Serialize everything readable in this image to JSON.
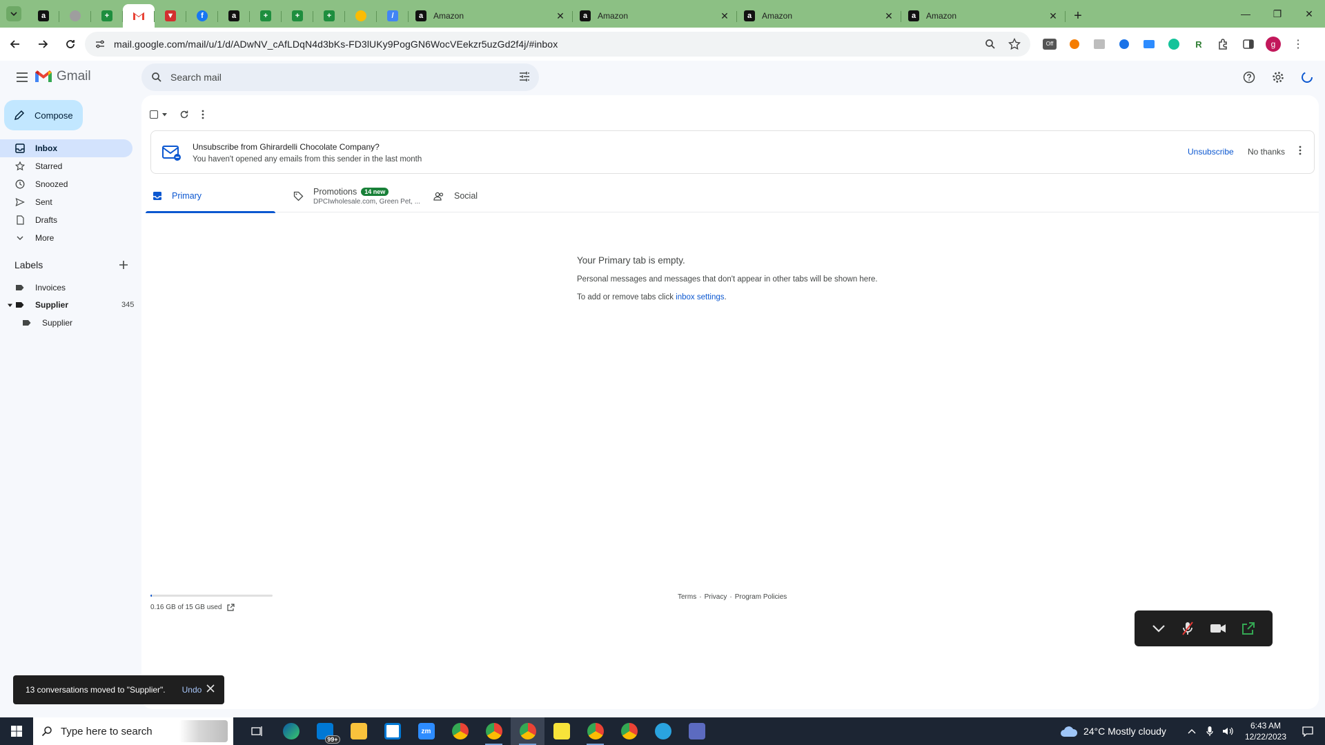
{
  "browser": {
    "tabs": [
      {
        "title": "Amazon"
      },
      {
        "title": "Amazon"
      },
      {
        "title": "Amazon"
      },
      {
        "title": "Amazon"
      }
    ],
    "url": "mail.google.com/mail/u/1/d/ADwNV_cAfLDqN4d3bKs-FD3lUKy9PogGN6WocVEekzr5uzGd2f4j/#inbox",
    "avatar_letter": "g"
  },
  "gmail": {
    "logo_text": "Gmail",
    "search_placeholder": "Search mail",
    "compose_label": "Compose",
    "nav": [
      {
        "label": "Inbox",
        "icon": "inbox-icon"
      },
      {
        "label": "Starred",
        "icon": "star-icon"
      },
      {
        "label": "Snoozed",
        "icon": "clock-icon"
      },
      {
        "label": "Sent",
        "icon": "send-icon"
      },
      {
        "label": "Drafts",
        "icon": "draft-icon"
      },
      {
        "label": "More",
        "icon": "chevron-down-icon"
      }
    ],
    "labels_title": "Labels",
    "labels": [
      {
        "label": "Invoices"
      },
      {
        "label": "Supplier",
        "count": "345"
      },
      {
        "label": "Supplier"
      }
    ],
    "banner": {
      "title": "Unsubscribe from Ghirardelli Chocolate Company?",
      "subtitle": "You haven't opened any emails from this sender in the last month",
      "unsubscribe": "Unsubscribe",
      "no_thanks": "No thanks"
    },
    "tabs": {
      "primary": "Primary",
      "promotions": "Promotions",
      "promotions_badge": "14 new",
      "promotions_sub": "DPCIwholesale.com, Green Pet, ...",
      "social": "Social"
    },
    "empty": {
      "title": "Your Primary tab is empty.",
      "line1": "Personal messages and messages that don't appear in other tabs will be shown here.",
      "line2_prefix": "To add or remove tabs click ",
      "line2_link": "inbox settings",
      "line2_suffix": "."
    },
    "storage": {
      "text": "0.16 GB of 15 GB used",
      "used_fraction": 0.011
    },
    "footer": {
      "terms": "Terms",
      "privacy": "Privacy",
      "policies": "Program Policies",
      "sep": "·"
    },
    "toast": {
      "message": "13 conversations moved to \"Supplier\".",
      "undo": "Undo"
    }
  },
  "taskbar": {
    "search_placeholder": "Type here to search",
    "weather": "24°C  Mostly cloudy",
    "time": "6:43 AM",
    "date": "12/22/2023",
    "mail_badge": "99+"
  },
  "colors": {
    "accent": "#0b57d0",
    "tabbar": "#8cc084",
    "compose_bg": "#c2e7ff",
    "badge_green": "#188038"
  }
}
